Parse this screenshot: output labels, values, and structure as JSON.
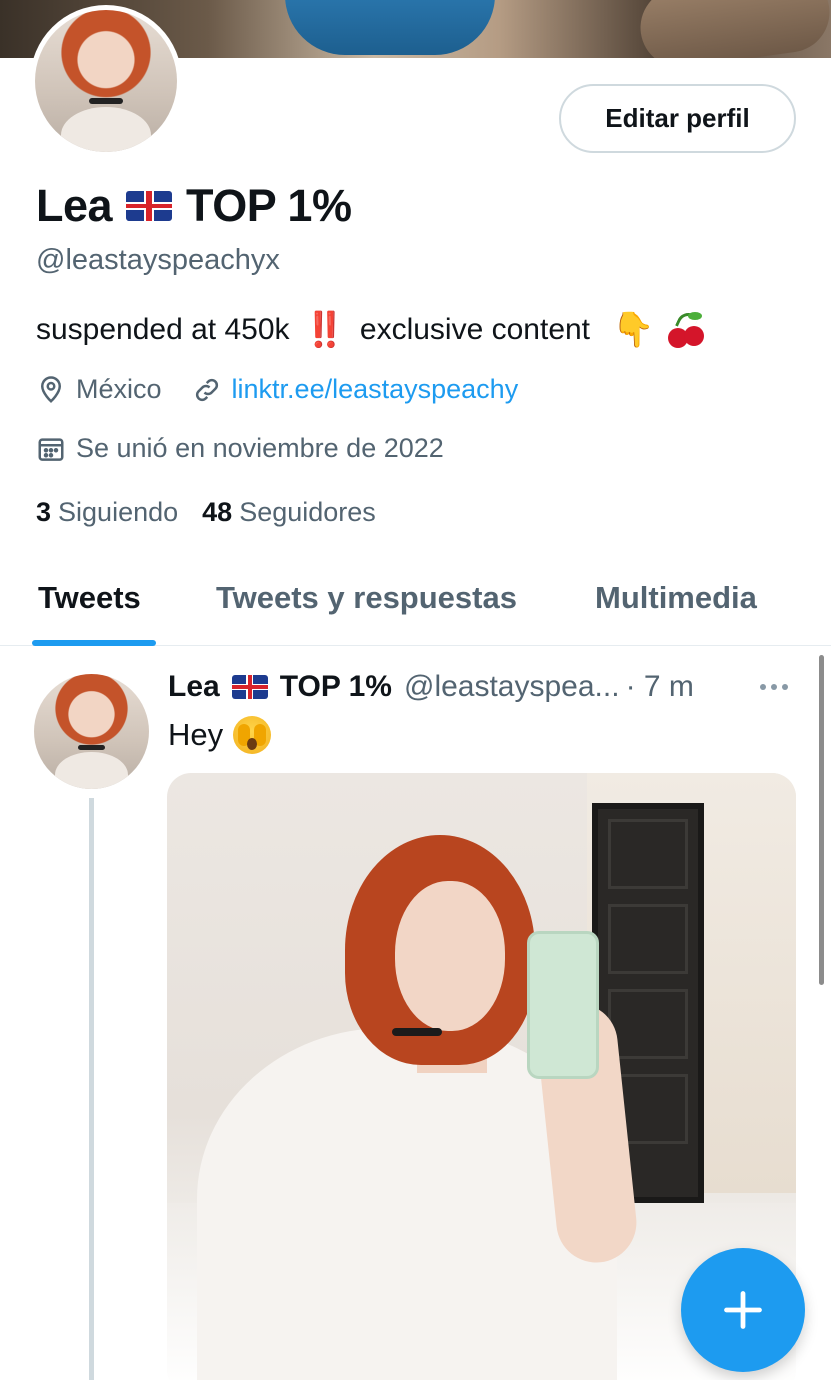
{
  "profile": {
    "name_prefix": "Lea",
    "name_suffix": "TOP 1%",
    "handle": "@leastayspeachyx",
    "bio_text": "suspended at 450k",
    "bio_bang": "‼️",
    "bio_text2": "exclusive content",
    "bio_hand": "👇",
    "location": "México",
    "link": "linktr.ee/leastayspeachy",
    "joined": "Se unió en noviembre de 2022",
    "following_count": "3",
    "following_label": "Siguiendo",
    "followers_count": "48",
    "followers_label": "Seguidores"
  },
  "actions": {
    "edit_profile": "Editar perfil"
  },
  "tabs": [
    {
      "label": "Tweets"
    },
    {
      "label": "Tweets y respuestas"
    },
    {
      "label": "Multimedia"
    }
  ],
  "tweet": {
    "name_prefix": "Lea",
    "name_suffix": "TOP 1%",
    "handle": "@leastayspea...",
    "time": "· 7 m",
    "text": "Hey"
  },
  "colors": {
    "accent": "#1d9bf0",
    "secondary_text": "#536471",
    "border": "#cfd9de"
  },
  "icons": {
    "location": "map-pin-icon",
    "link": "link-icon",
    "calendar": "calendar-icon",
    "more": "more-horizontal-icon",
    "compose": "plus-icon"
  }
}
